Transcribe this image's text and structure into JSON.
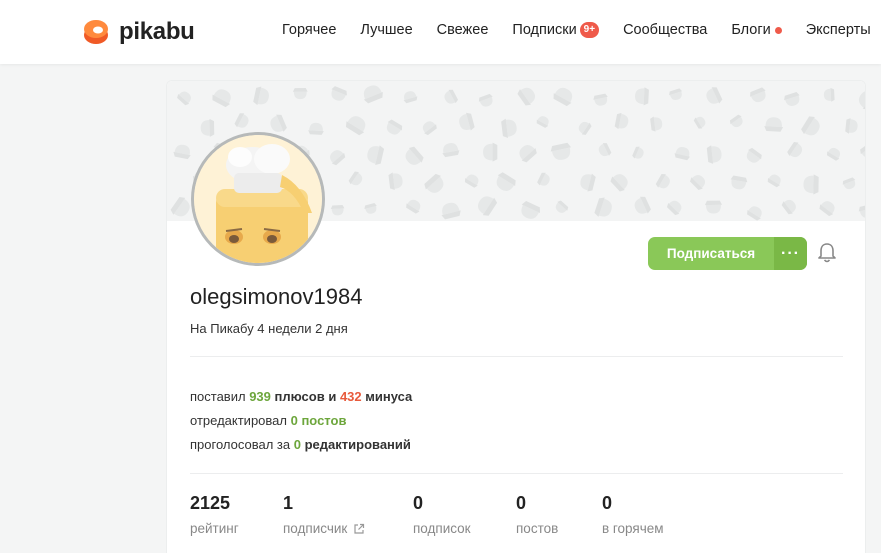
{
  "header": {
    "logo_text": "pikabu",
    "nav": [
      {
        "label": "Горячее"
      },
      {
        "label": "Лучшее"
      },
      {
        "label": "Свежее"
      },
      {
        "label": "Подписки",
        "badge": "9+"
      },
      {
        "label": "Сообщества"
      },
      {
        "label": "Блоги",
        "dot": true
      },
      {
        "label": "Эксперты"
      }
    ]
  },
  "profile": {
    "username": "olegsimonov1984",
    "since": "На Пикабу 4 недели 2 дня",
    "subscribe_label": "Подписаться",
    "more_label": "···",
    "activity": {
      "line1": {
        "prefix": "поставил",
        "pluses": "939",
        "middle": "плюсов и",
        "minuses": "432",
        "suffix": "минуса"
      },
      "line2": {
        "prefix": "отредактировал",
        "value": "0 постов"
      },
      "line3": {
        "prefix": "проголосовал за",
        "value": "0",
        "suffix": "редактирований"
      }
    },
    "counters": [
      {
        "value": "2125",
        "label": "рейтинг"
      },
      {
        "value": "1",
        "label": "подписчик",
        "external_icon": "external-link-icon"
      },
      {
        "value": "0",
        "label": "подписок"
      },
      {
        "value": "0",
        "label": "постов"
      },
      {
        "value": "0",
        "label": "в горячем"
      }
    ]
  },
  "colors": {
    "accent_green": "#8ac858",
    "plus_green": "#6da63c",
    "minus_red": "#e85a3c",
    "badge_red": "#ef5a4a",
    "logo_orange": "#ff7a2e"
  },
  "icons": {
    "logo": "pikabu-logo-icon",
    "bell": "bell-icon",
    "avatar": "chef-toast-avatar"
  }
}
